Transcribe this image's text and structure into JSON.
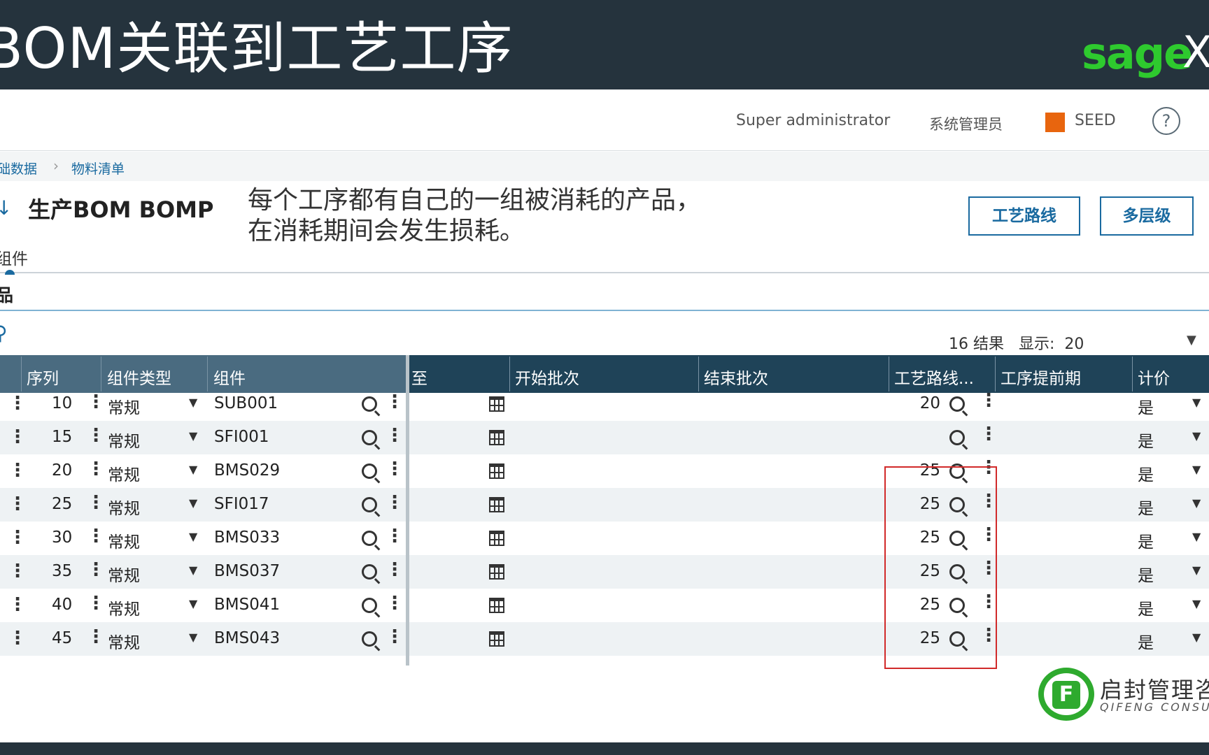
{
  "slide": {
    "title": "BOM关联到工艺工序",
    "brand": "sage",
    "brand_suffix": "X"
  },
  "header": {
    "user": "Super administrator",
    "role": "系统管理员",
    "folder": "SEED",
    "folder_color": "#e8650e",
    "help": "?"
  },
  "breadcrumb": [
    "础数据",
    "物料清单"
  ],
  "page": {
    "title": "生产BOM BOMP",
    "annotation_line1": "每个工序都有自己的一组被消耗的产品，",
    "annotation_line2": "在消耗期间会发生损耗。"
  },
  "actions": {
    "routing": "工艺路线",
    "multilevel": "多层级"
  },
  "tab": {
    "label": "组件"
  },
  "section": {
    "title": "品"
  },
  "results": {
    "text": "16 结果",
    "display_label": "显示:",
    "display_value": "20"
  },
  "columns": {
    "seq": "序列",
    "type": "组件类型",
    "component": "组件",
    "to": "至",
    "start_lot": "开始批次",
    "end_lot": "结束批次",
    "routing_op": "工艺路线...",
    "lead_time": "工序提前期",
    "pricing": "计价"
  },
  "rows": [
    {
      "seq": "10",
      "type": "常规",
      "component": "SUB001",
      "op": "20",
      "pricing": "是"
    },
    {
      "seq": "15",
      "type": "常规",
      "component": "SFI001",
      "op": "",
      "pricing": "是"
    },
    {
      "seq": "20",
      "type": "常规",
      "component": "BMS029",
      "op": "25",
      "pricing": "是"
    },
    {
      "seq": "25",
      "type": "常规",
      "component": "SFI017",
      "op": "25",
      "pricing": "是"
    },
    {
      "seq": "30",
      "type": "常规",
      "component": "BMS033",
      "op": "25",
      "pricing": "是"
    },
    {
      "seq": "35",
      "type": "常规",
      "component": "BMS037",
      "op": "25",
      "pricing": "是"
    },
    {
      "seq": "40",
      "type": "常规",
      "component": "BMS041",
      "op": "25",
      "pricing": "是"
    },
    {
      "seq": "45",
      "type": "常规",
      "component": "BMS043",
      "op": "25",
      "pricing": "是"
    }
  ],
  "watermark": {
    "name": "启封管理咨",
    "sub": "QIFENG CONSUL",
    "mark": "F"
  }
}
